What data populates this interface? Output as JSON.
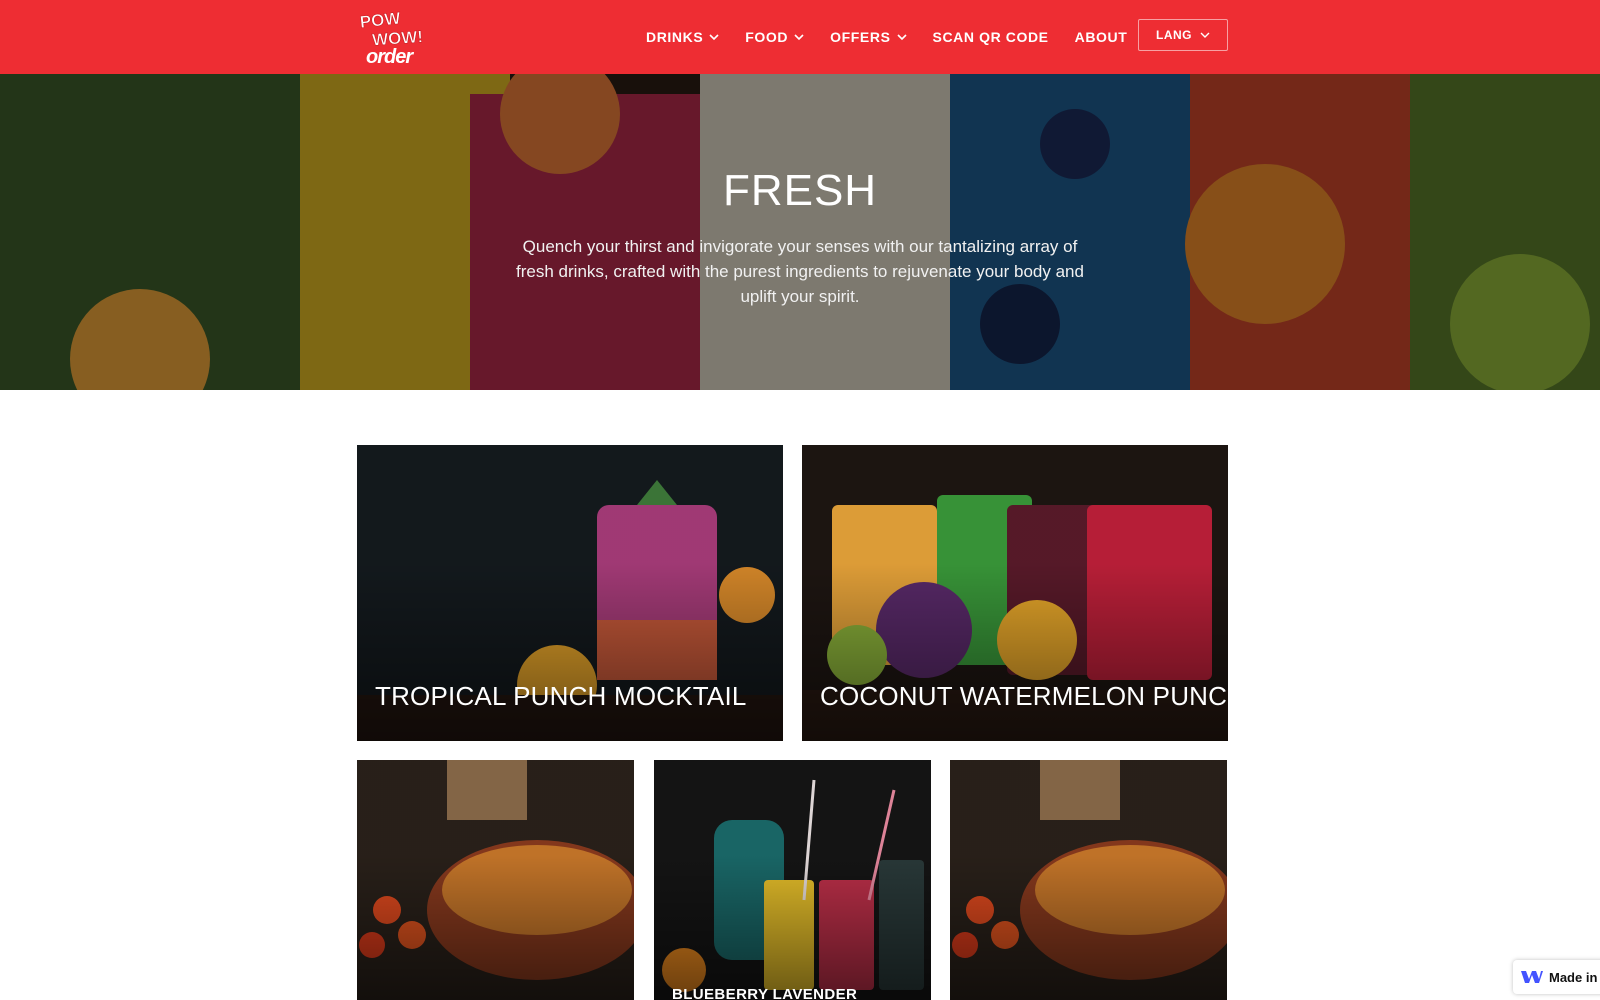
{
  "brand": {
    "logo_word": "order",
    "logo_stack": "POW WOW!"
  },
  "nav": {
    "items": [
      {
        "label": "DRINKS",
        "has_dropdown": true
      },
      {
        "label": "FOOD",
        "has_dropdown": true
      },
      {
        "label": "OFFERS",
        "has_dropdown": true
      },
      {
        "label": "SCAN QR CODE",
        "has_dropdown": false
      },
      {
        "label": "ABOUT",
        "has_dropdown": false
      }
    ],
    "lang_label": "LANG",
    "chevron_icon": "chevron-down-icon"
  },
  "hero": {
    "title": "FRESH",
    "text": "Quench your thirst and invigorate your senses with our tantalizing array of fresh drinks, crafted with the purest ingredients to rejuvenate your body and uplift your spirit."
  },
  "cards": [
    {
      "title": "TROPICAL PUNCH MOCKTAIL"
    },
    {
      "title": "COCONUT WATERMELON PUNCH"
    },
    {
      "title": ""
    },
    {
      "title": "BLUEBERRY LAVENDER"
    },
    {
      "title": ""
    }
  ],
  "badge": {
    "label": "Made in",
    "icon": "webflow-icon"
  },
  "colors": {
    "brand_red": "#ee2d33",
    "white": "#ffffff"
  }
}
